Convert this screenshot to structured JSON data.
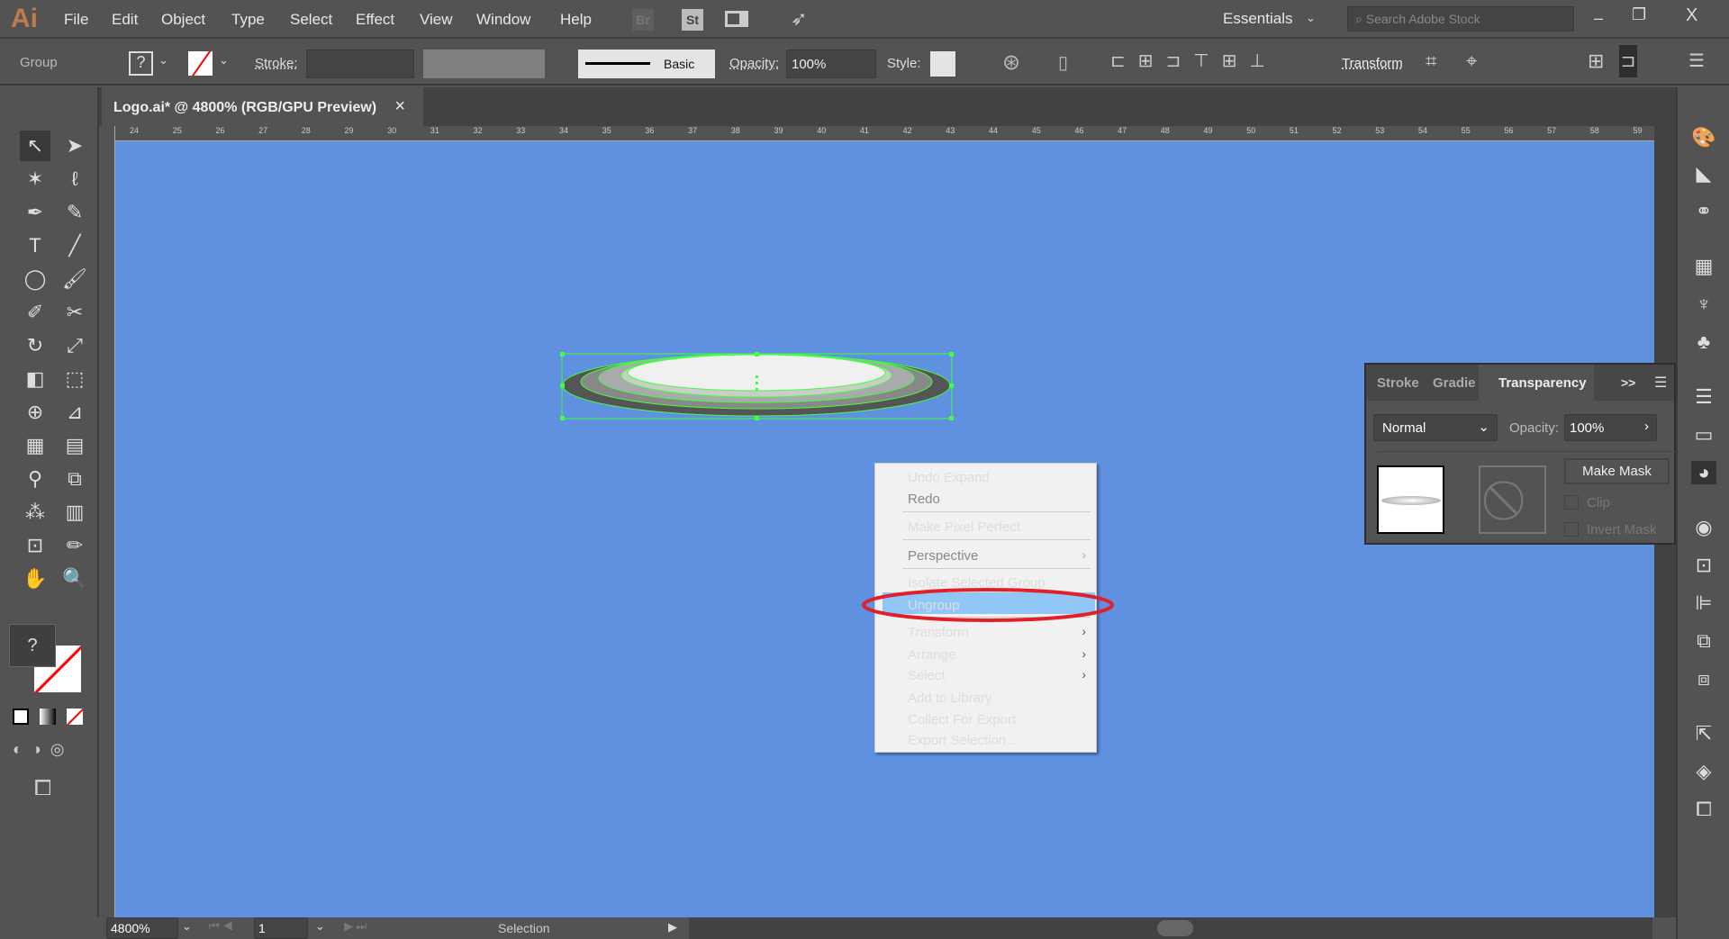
{
  "app": {
    "logo": "Ai"
  },
  "menu": [
    "File",
    "Edit",
    "Object",
    "Type",
    "Select",
    "Effect",
    "View",
    "Window",
    "Help"
  ],
  "menu_icons": {
    "bridge": "Br",
    "stock": "St"
  },
  "workspace": "Essentials",
  "search": {
    "placeholder": "Search Adobe Stock"
  },
  "window_controls": {
    "close": "X"
  },
  "control": {
    "selection_type": "Group",
    "fill": "?",
    "stroke_label": "Stroke:",
    "brush": "Basic",
    "opacity_label": "Opacity:",
    "opacity_value": "100%",
    "style_label": "Style:",
    "transform_link": "Transform"
  },
  "document": {
    "tab_title": "Logo.ai* @ 4800% (RGB/GPU Preview)",
    "close": "×"
  },
  "ruler": {
    "top": [
      "24",
      "25",
      "26",
      "27",
      "28",
      "29",
      "30",
      "31",
      "32",
      "33",
      "34",
      "35",
      "36",
      "37",
      "38",
      "39",
      "40",
      "41",
      "42",
      "43",
      "44",
      "45",
      "46",
      "47",
      "48",
      "49",
      "50",
      "51",
      "52",
      "53",
      "54",
      "55",
      "56",
      "57",
      "58",
      "59"
    ]
  },
  "tools": {
    "fill_unknown": "?"
  },
  "context_menu": {
    "items": [
      {
        "label": "Undo Expand",
        "disabled": false
      },
      {
        "label": "Redo",
        "disabled": true
      },
      {
        "label": "Make Pixel Perfect",
        "disabled": false
      },
      {
        "label": "Perspective",
        "disabled": true,
        "submenu": true
      },
      {
        "label": "Isolate Selected Group",
        "disabled": false
      },
      {
        "label": "Ungroup",
        "disabled": false,
        "highlighted": true
      },
      {
        "label": "Transform",
        "disabled": false,
        "submenu": true
      },
      {
        "label": "Arrange",
        "disabled": false,
        "submenu": true
      },
      {
        "label": "Select",
        "disabled": false,
        "submenu": true
      },
      {
        "label": "Add to Library",
        "disabled": false
      },
      {
        "label": "Collect For Export",
        "disabled": false
      },
      {
        "label": "Export Selection...",
        "disabled": false
      }
    ]
  },
  "transparency_panel": {
    "tabs": [
      "Stroke",
      "Gradie",
      "Transparency"
    ],
    "active_tab": "Transparency",
    "blend_mode": "Normal",
    "opacity_label": "Opacity:",
    "opacity_value": "100%",
    "make_mask": "Make Mask",
    "clip": "Clip",
    "invert_mask": "Invert Mask",
    "expand": ">>"
  },
  "status": {
    "zoom": "4800%",
    "artboard": "1",
    "tool": "Selection"
  },
  "colors": {
    "canvas": "#6090e0",
    "highlight": "#90c7f7",
    "annotation": "#e0202a",
    "selection": "#40ff40"
  }
}
